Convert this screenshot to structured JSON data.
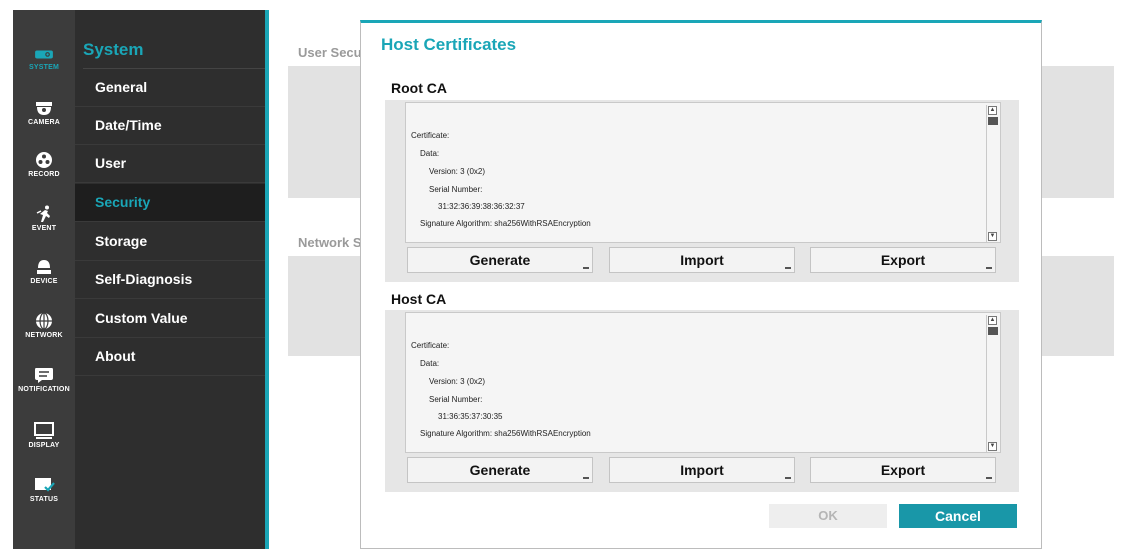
{
  "rail": [
    {
      "label": "SYSTEM",
      "icon": "system-icon",
      "active": true
    },
    {
      "label": "CAMERA",
      "icon": "camera-icon"
    },
    {
      "label": "RECORD",
      "icon": "record-icon"
    },
    {
      "label": "EVENT",
      "icon": "event-icon"
    },
    {
      "label": "DEVICE",
      "icon": "device-icon"
    },
    {
      "label": "NETWORK",
      "icon": "network-icon"
    },
    {
      "label": "NOTIFICATION",
      "icon": "notification-icon"
    },
    {
      "label": "DISPLAY",
      "icon": "display-icon"
    },
    {
      "label": "STATUS",
      "icon": "status-icon"
    }
  ],
  "submenu": {
    "title": "System",
    "items": [
      {
        "label": "General"
      },
      {
        "label": "Date/Time"
      },
      {
        "label": "User"
      },
      {
        "label": "Security",
        "active": true
      },
      {
        "label": "Storage"
      },
      {
        "label": "Self-Diagnosis"
      },
      {
        "label": "Custom Value"
      },
      {
        "label": "About"
      }
    ]
  },
  "background": {
    "user_security_label": "User Secu",
    "network_security_label": "Network S"
  },
  "dialog": {
    "title": "Host Certificates",
    "root_ca": {
      "title": "Root CA",
      "lines": [
        "Certificate:",
        "Data:",
        "Version: 3 (0x2)",
        "Serial Number:",
        "31:32:36:39:38:36:32:37",
        "Signature Algorithm: sha256WithRSAEncryption"
      ],
      "generate_label": "Generate",
      "import_label": "Import",
      "export_label": "Export"
    },
    "host_ca": {
      "title": "Host CA",
      "lines": [
        "Certificate:",
        "Data:",
        "Version: 3 (0x2)",
        "Serial Number:",
        "31:36:35:37:30:35",
        "Signature Algorithm: sha256WithRSAEncryption"
      ],
      "generate_label": "Generate",
      "import_label": "Import",
      "export_label": "Export"
    },
    "ok_label": "OK",
    "cancel_label": "Cancel",
    "scroll_up_glyph": "▲",
    "scroll_down_glyph": "▼"
  },
  "colors": {
    "accent": "#1aa6b7",
    "rail_bg": "#3c3c3c",
    "submenu_bg": "#2e2e2e",
    "cancel_bg": "#1997a8"
  }
}
